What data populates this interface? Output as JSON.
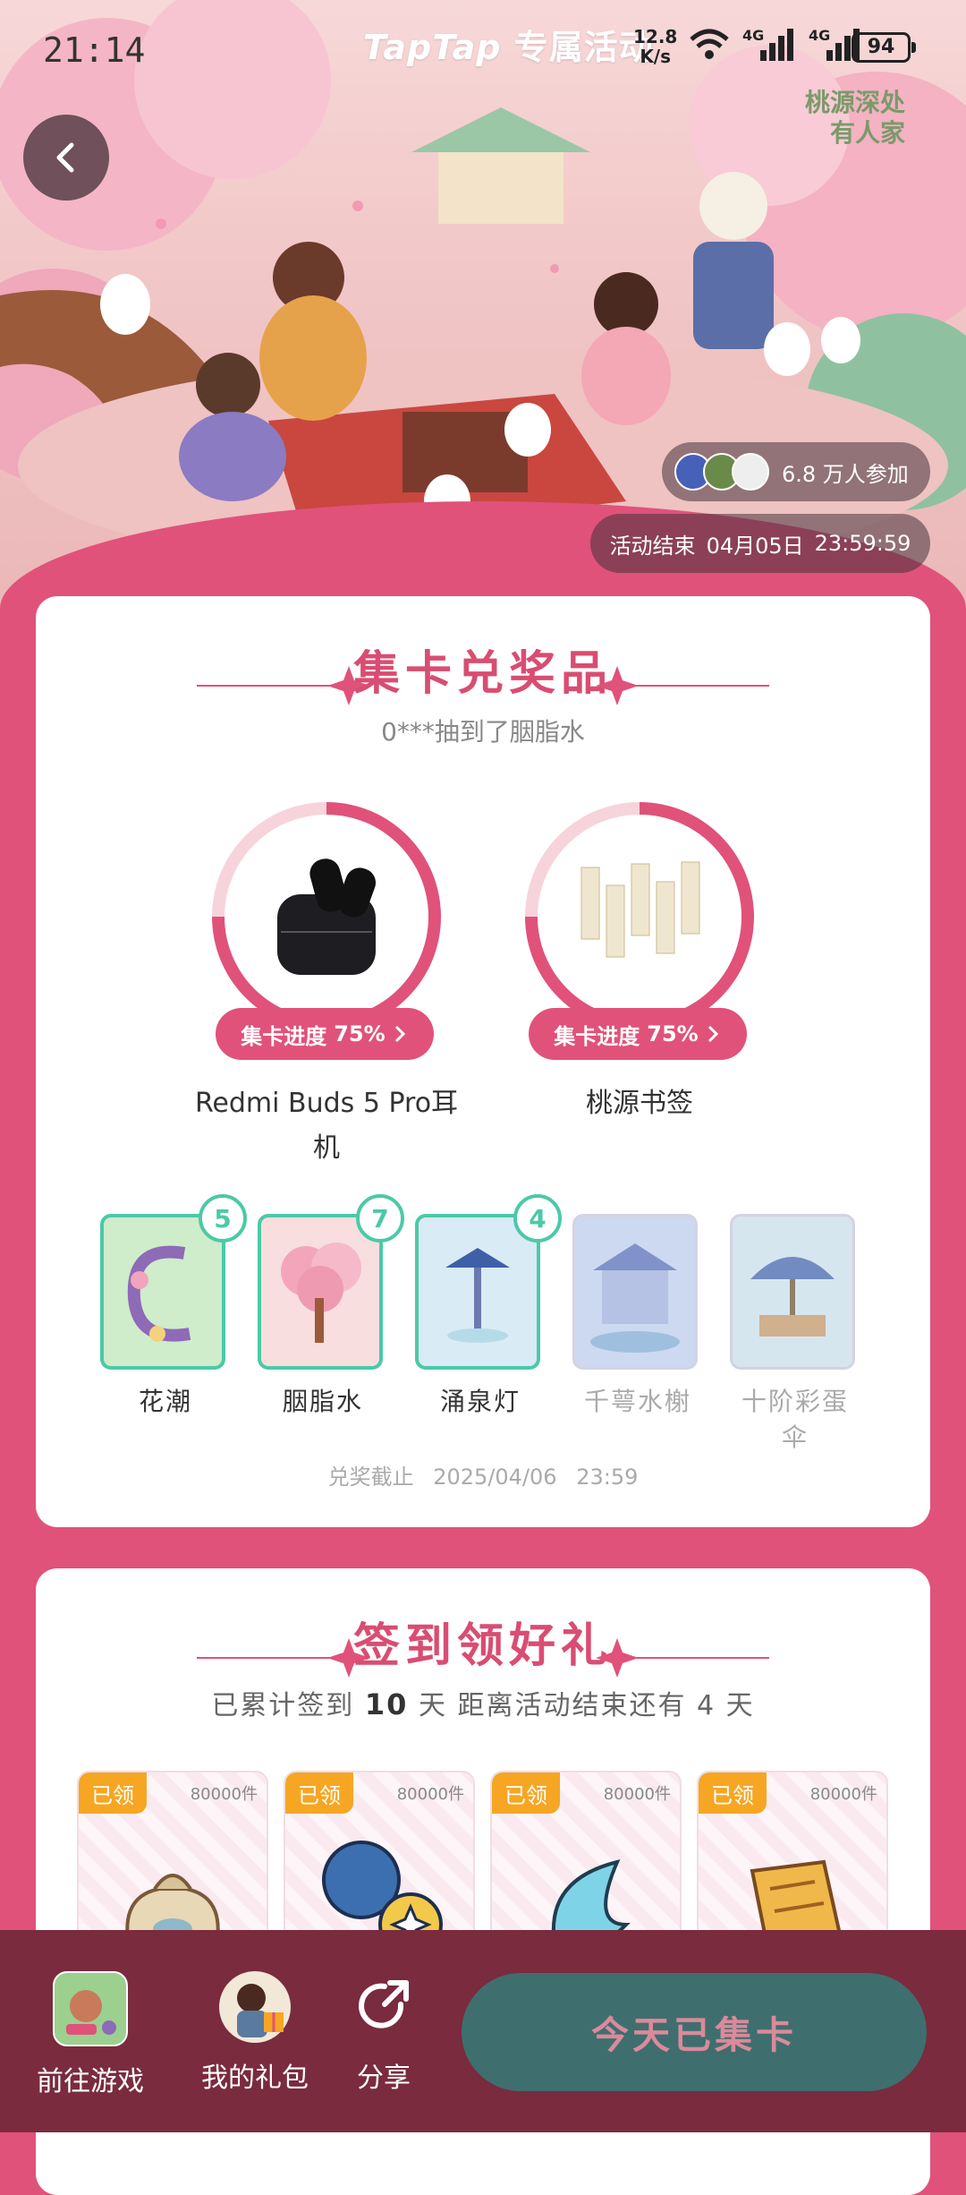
{
  "status_bar": {
    "time": "21:14",
    "brand_en": "TapTap",
    "brand_cn": "专属活动",
    "net_speed_value": "12.8",
    "net_speed_unit": "K/s",
    "network_1": "4G",
    "network_2": "4G",
    "battery": "94"
  },
  "hero": {
    "logo_line1": "桃源深处",
    "logo_line2": "有人家",
    "participants": "6.8 万人参加",
    "end_label": "活动结束",
    "end_date": "04月05日",
    "end_time": "23:59:59"
  },
  "collect": {
    "title": "集卡兑奖品",
    "ticker": "0***抽到了胭脂水",
    "prizes": [
      {
        "name": "Redmi Buds 5 Pro耳机",
        "progress_label": "集卡进度",
        "progress_text": "75%",
        "progress": 0.75
      },
      {
        "name": "桃源书签",
        "progress_label": "集卡进度",
        "progress_text": "75%",
        "progress": 0.75
      }
    ],
    "cards": [
      {
        "label": "花潮",
        "count": "5",
        "owned": true
      },
      {
        "label": "胭脂水",
        "count": "7",
        "owned": true
      },
      {
        "label": "涌泉灯",
        "count": "4",
        "owned": true
      },
      {
        "label": "千萼水榭",
        "count": "",
        "owned": false
      },
      {
        "label": "十阶彩蛋伞",
        "count": "",
        "owned": false
      }
    ],
    "deadline_label": "兑奖截止",
    "deadline_date": "2025/04/06",
    "deadline_time": "23:59"
  },
  "signin": {
    "title": "签到领好礼",
    "sub_prefix": "已累计签到",
    "days": "10",
    "sub_mid": "天  距离活动结束还有",
    "remaining": "4",
    "sub_suffix": "天",
    "gifts": [
      {
        "tag": "已领",
        "count": "80000件"
      },
      {
        "tag": "已领",
        "count": "80000件"
      },
      {
        "tag": "已领",
        "count": "80000件"
      },
      {
        "tag": "已领",
        "count": "80000件"
      }
    ]
  },
  "bottom_bar": {
    "play_label": "前往游戏",
    "gifts_label": "我的礼包",
    "share_label": "分享",
    "collect_button": "今天已集卡"
  },
  "colors": {
    "primary": "#e0527a",
    "accent_green": "#4cc9a7",
    "bottom_bar": "#7a2b3e",
    "button": "#3f6e6e",
    "tag_orange": "#f6a623"
  }
}
